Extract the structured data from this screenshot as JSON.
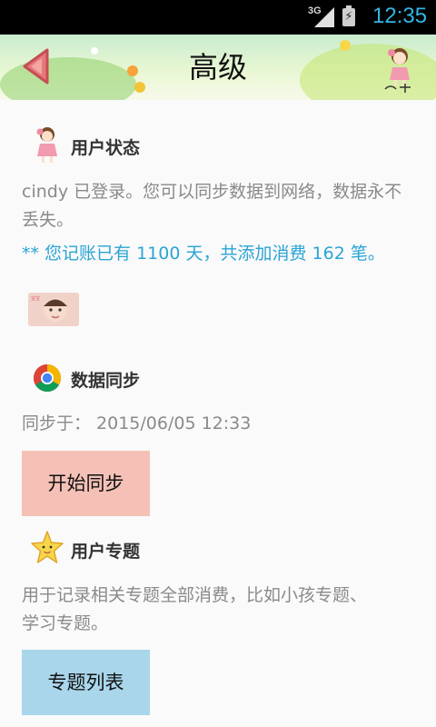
{
  "status_bar": {
    "network": "3G",
    "time": "12:35"
  },
  "header": {
    "title": "高级"
  },
  "user_status": {
    "title": "用户状态",
    "description": "cindy 已登录。您可以同步数据到网络，数据永不丢失。",
    "stats": "** 您记账已有 1100 天，共添加消费 162 笔。"
  },
  "data_sync": {
    "title": "数据同步",
    "last_sync": "同步于： 2015/06/05 12:33",
    "button_label": "开始同步"
  },
  "topics": {
    "title": "用户专题",
    "description": "用于记录相关专题全部消费，比如小孩专题、学习专题。",
    "button_label": "专题列表"
  },
  "colors": {
    "accent": "#33b5e5",
    "highlight_text": "#2aa4d5",
    "sync_button": "#f5c1b7",
    "topics_button": "#a9d6ea"
  }
}
